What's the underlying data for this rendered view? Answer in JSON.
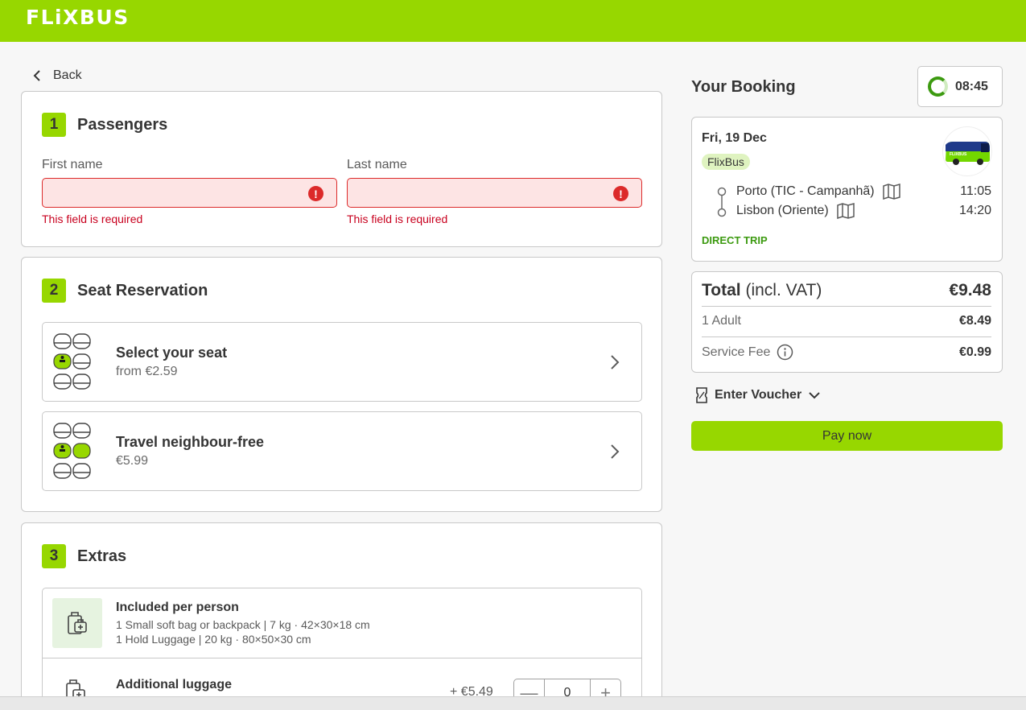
{
  "brand": {
    "logo_text": "FLiXBUS",
    "accent": "#97d700",
    "error_color": "#dc2a2a"
  },
  "nav": {
    "back_label": "Back"
  },
  "passengers": {
    "number": "1",
    "title": "Passengers",
    "first_name_label": "First name",
    "last_name_label": "Last name",
    "first_name_value": "",
    "last_name_value": "",
    "error_text": "This field is required"
  },
  "seats": {
    "number": "2",
    "title": "Seat Reservation",
    "options": [
      {
        "title": "Select your seat",
        "subtitle": "from €2.59"
      },
      {
        "title": "Travel neighbour-free",
        "subtitle": "€5.99"
      }
    ]
  },
  "extras": {
    "number": "3",
    "title": "Extras",
    "included_title": "Included per person",
    "included_lines": [
      "1 Small soft bag or backpack | 7 kg · 42×30×18 cm",
      "1 Hold Luggage | 20 kg · 80×50×30 cm"
    ],
    "additional_title": "Additional luggage",
    "additional_price": "+ €5.49",
    "additional_qty": "0"
  },
  "booking": {
    "title": "Your Booking",
    "timer": "08:45",
    "date": "Fri, 19 Dec",
    "carrier": "FlixBus",
    "bus_logo_text": "FLIXBUS",
    "from_stop": "Porto (TIC - Campanhã)",
    "from_time": "11:05",
    "to_stop": "Lisbon (Oriente)",
    "to_time": "14:20",
    "trip_type": "DIRECT TRIP"
  },
  "summary": {
    "total_label": "Total",
    "total_suffix": "(incl. VAT)",
    "total_value": "€9.48",
    "rows": [
      {
        "label": "1 Adult",
        "value": "€8.49"
      },
      {
        "label": "Service Fee",
        "value": "€0.99"
      }
    ]
  },
  "voucher_label": "Enter Voucher",
  "pay_label": "Pay now",
  "icons": [
    "chevron-left-icon",
    "error-icon",
    "seat-map-icon",
    "chevron-right-icon",
    "luggage-icon",
    "timer-icon",
    "map-icon",
    "info-icon",
    "voucher-icon",
    "chevron-down-icon"
  ]
}
